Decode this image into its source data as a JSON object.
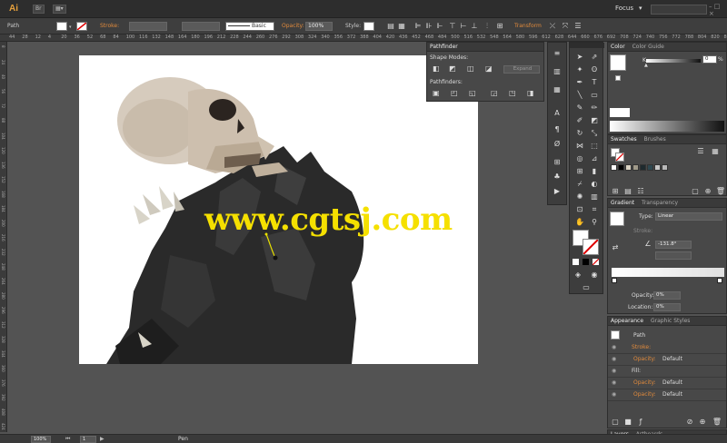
{
  "app": {
    "logo": "Ai",
    "bridge_label": "Br",
    "arrange_label": "▦▾",
    "workspace": "Focus",
    "workspace_arrow": "▾",
    "window_controls": "– □ ×"
  },
  "control_bar": {
    "object_type": "Path",
    "stroke_label": "Stroke:",
    "brush_label": "Basic",
    "opacity_label": "Opacity:",
    "opacity_value": "100%",
    "style_label": "Style:",
    "transform_label": "Transform"
  },
  "ruler_marks": [
    "44",
    "28",
    "12",
    "4",
    "20",
    "36",
    "52",
    "68",
    "84",
    "100",
    "116",
    "132",
    "148",
    "164",
    "180",
    "196",
    "212",
    "228",
    "244",
    "260",
    "276",
    "292",
    "308",
    "324",
    "340",
    "356",
    "372",
    "388",
    "404",
    "420",
    "436",
    "452",
    "468",
    "484",
    "500",
    "516",
    "532",
    "548",
    "564",
    "580",
    "596",
    "612",
    "628",
    "644",
    "660",
    "676",
    "692",
    "708",
    "724",
    "740",
    "756",
    "772",
    "788",
    "804",
    "820",
    "836"
  ],
  "vertical_ruler_marks": [
    "8",
    "24",
    "40",
    "56",
    "72",
    "88",
    "104",
    "120",
    "136",
    "152",
    "168",
    "184",
    "200",
    "216",
    "232",
    "248",
    "264",
    "280",
    "296",
    "312",
    "328",
    "344",
    "360",
    "376",
    "392",
    "408",
    "424"
  ],
  "watermark": "www.cgtsj.com",
  "pathfinder": {
    "title": "Pathfinder",
    "shape_modes_label": "Shape Modes:",
    "expand_label": "Expand",
    "pathfinders_label": "Pathfinders:"
  },
  "color_panel": {
    "tab_color": "Color",
    "tab_guide": "Color Guide",
    "k_label": "K",
    "k_value": "0",
    "k_unit": "%"
  },
  "swatches_panel": {
    "tab_swatches": "Swatches",
    "tab_brushes": "Brushes",
    "swatch_colors": [
      "#ffffff",
      "#000000",
      "#d9d2c2",
      "#a09a8a",
      "#1e2a2e",
      "#2e4850",
      "#c8c8c8",
      "#b8b8b8"
    ]
  },
  "gradient_panel": {
    "tab_gradient": "Gradient",
    "tab_transparency": "Transparency",
    "type_label": "Type:",
    "type_value": "Linear",
    "stroke_label": "Stroke:",
    "angle_value": "-131.8°",
    "opacity_label": "Opacity:",
    "opacity_value": "0%",
    "location_label": "Location:",
    "location_value": "0%"
  },
  "appearance_panel": {
    "tab_appearance": "Appearance",
    "tab_graphic_styles": "Graphic Styles",
    "object_label": "Path",
    "rows": [
      {
        "label": "Stroke:",
        "detail": "",
        "orange": true
      },
      {
        "label": "Opacity:",
        "detail": "Default",
        "orange": true
      },
      {
        "label": "Fill:",
        "detail": "",
        "orange": false
      },
      {
        "label": "Opacity:",
        "detail": "Default",
        "orange": true
      },
      {
        "label": "Opacity:",
        "detail": "Default",
        "orange": true
      }
    ]
  },
  "layers_panel": {
    "tab_layers": "Layers",
    "tab_artboards": "Artboards"
  },
  "status_bar": {
    "zoom": "100%",
    "artboard": "1",
    "tool": "Pen"
  }
}
